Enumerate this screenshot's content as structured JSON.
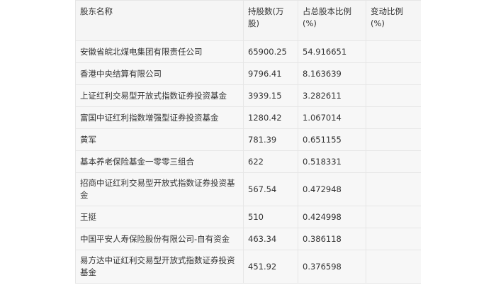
{
  "header": {
    "name": "股东名称",
    "shares": "持股数(万股)",
    "ratio": "占总股本比例(%)",
    "change": "变动比例(%)"
  },
  "rows": [
    {
      "name": "安徽省皖北煤电集团有限责任公司",
      "shares": "65900.25",
      "ratio": "54.916651",
      "change": ""
    },
    {
      "name": "香港中央结算有限公司",
      "shares": "9796.41",
      "ratio": "8.163639",
      "change": ""
    },
    {
      "name": "上证红利交易型开放式指数证券投资基金",
      "shares": "3939.15",
      "ratio": "3.282611",
      "change": ""
    },
    {
      "name": "富国中证红利指数增强型证券投资基金",
      "shares": "1280.42",
      "ratio": "1.067014",
      "change": ""
    },
    {
      "name": "黄军",
      "shares": "781.39",
      "ratio": "0.651155",
      "change": ""
    },
    {
      "name": "基本养老保险基金一零零三组合",
      "shares": "622",
      "ratio": "0.518331",
      "change": ""
    },
    {
      "name": "招商中证红利交易型开放式指数证券投资基金",
      "shares": "567.54",
      "ratio": "0.472948",
      "change": ""
    },
    {
      "name": "王挺",
      "shares": "510",
      "ratio": "0.424998",
      "change": ""
    },
    {
      "name": "中国平安人寿保险股份有限公司-自有资金",
      "shares": "463.34",
      "ratio": "0.386118",
      "change": ""
    },
    {
      "name": "易方达中证红利交易型开放式指数证券投资基金",
      "shares": "451.92",
      "ratio": "0.376598",
      "change": ""
    }
  ]
}
